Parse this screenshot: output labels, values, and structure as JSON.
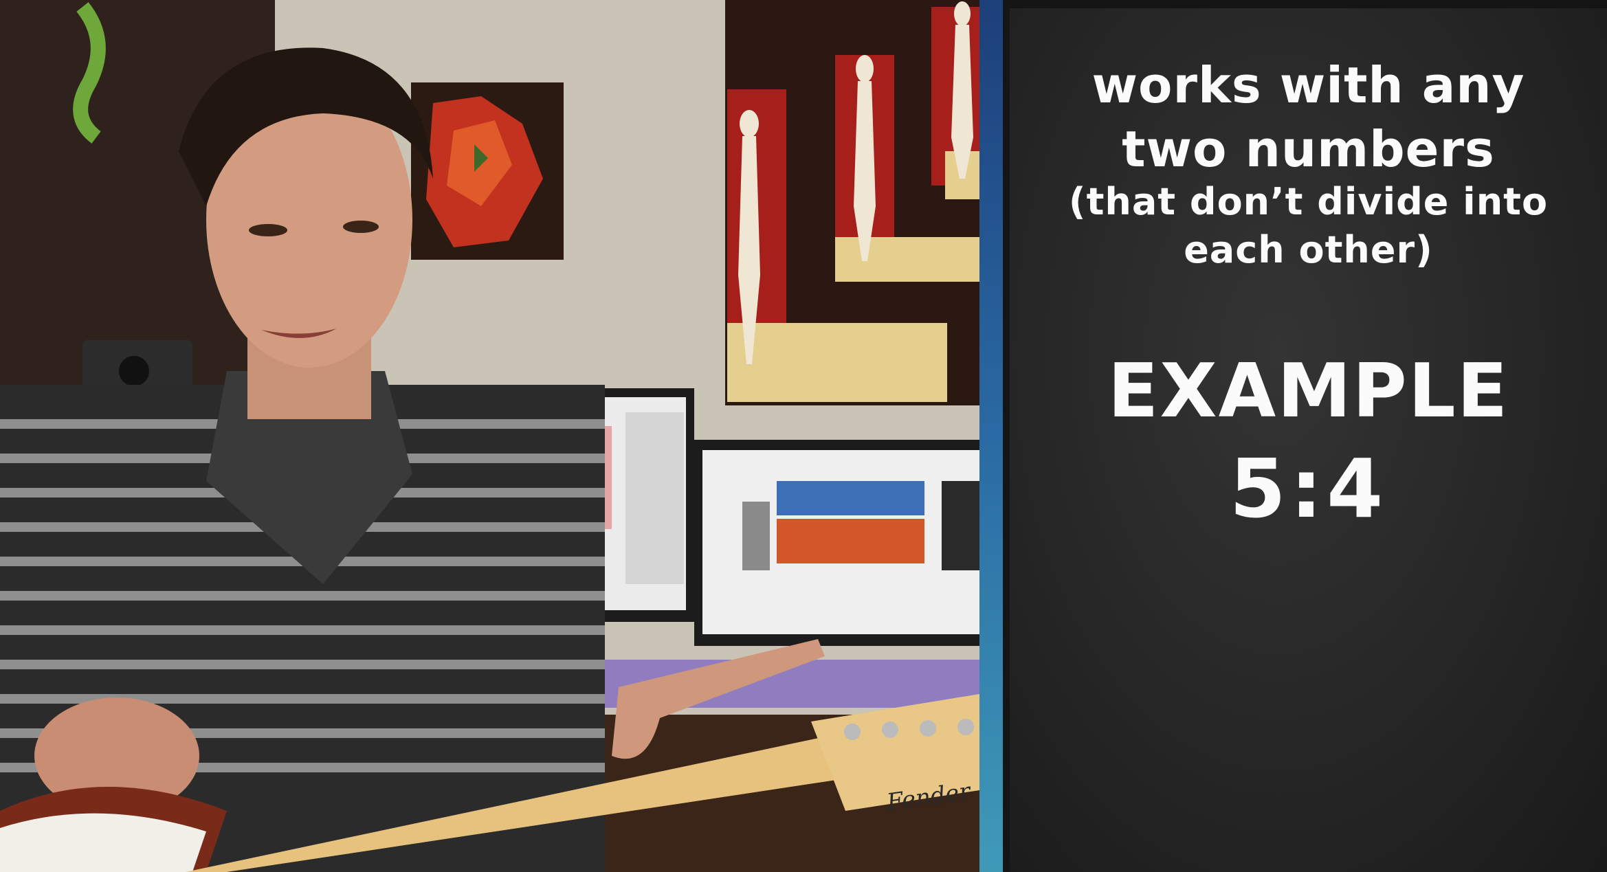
{
  "panel": {
    "line1": "works with any",
    "line2": "two numbers",
    "line3": "(that don’t divide into",
    "line4": "each other)",
    "example_label": "EXAMPLE",
    "ratio": "5:4"
  },
  "photo": {
    "guitar_brand": "Fender"
  },
  "colors": {
    "panel_background": "#2a2a2a",
    "panel_text": "#fbfbfb",
    "divider": "#2a6aa4",
    "wall": "#c9c4b6",
    "shirt": "#2b2b2b"
  }
}
